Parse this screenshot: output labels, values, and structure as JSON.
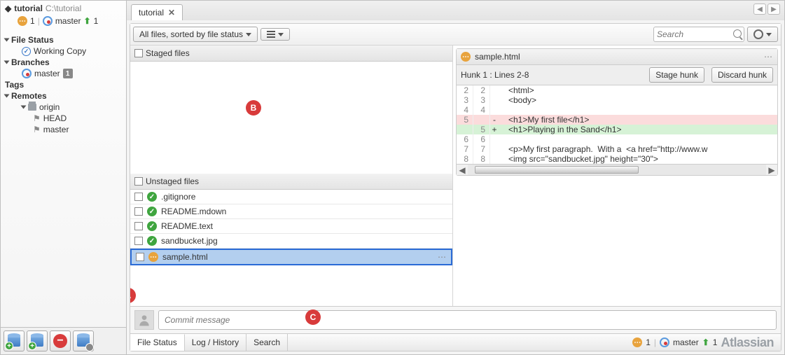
{
  "repo": {
    "name": "tutorial",
    "path": "C:\\tutorial",
    "pending": "1",
    "branch": "master",
    "ahead": "1"
  },
  "sidebar": {
    "file_status": "File Status",
    "working_copy": "Working Copy",
    "branches": "Branches",
    "master": "master",
    "master_count": "1",
    "tags": "Tags",
    "remotes": "Remotes",
    "origin": "origin",
    "head": "HEAD",
    "remote_master": "master"
  },
  "tab": {
    "label": "tutorial"
  },
  "toolbar": {
    "filter": "All files, sorted by file status"
  },
  "search": {
    "placeholder": "Search"
  },
  "staged_header": "Staged files",
  "unstaged_header": "Unstaged files",
  "unstaged": [
    {
      "name": ".gitignore",
      "status": "clean"
    },
    {
      "name": "README.mdown",
      "status": "clean"
    },
    {
      "name": "README.text",
      "status": "clean"
    },
    {
      "name": "sandbucket.jpg",
      "status": "clean"
    },
    {
      "name": "sample.html",
      "status": "modified",
      "selected": true
    }
  ],
  "diff": {
    "filename": "sample.html",
    "hunk": "Hunk 1 : Lines 2-8",
    "stage_btn": "Stage hunk",
    "discard_btn": "Discard hunk",
    "lines": [
      {
        "a": "2",
        "b": "2",
        "m": " ",
        "t": "   <html>"
      },
      {
        "a": "3",
        "b": "3",
        "m": " ",
        "t": "   <body>"
      },
      {
        "a": "4",
        "b": "4",
        "m": " ",
        "t": ""
      },
      {
        "a": "5",
        "b": "",
        "m": "-",
        "t": "   <h1>My first file</h1>",
        "cls": "del"
      },
      {
        "a": "",
        "b": "5",
        "m": "+",
        "t": "   <h1>Playing in the Sand</h1>",
        "cls": "add"
      },
      {
        "a": "6",
        "b": "6",
        "m": " ",
        "t": ""
      },
      {
        "a": "7",
        "b": "7",
        "m": " ",
        "t": "   <p>My first paragraph.  With a  <a href=\"http://www.w"
      },
      {
        "a": "8",
        "b": "8",
        "m": " ",
        "t": "   <img src=\"sandbucket.jpg\" height=\"30\">"
      }
    ]
  },
  "commit": {
    "placeholder": "Commit message"
  },
  "footer": {
    "tabs": [
      "File Status",
      "Log / History",
      "Search"
    ],
    "pending": "1",
    "branch": "master",
    "ahead": "1",
    "brand": "Atlassian"
  },
  "markers": {
    "a": "A",
    "b": "B",
    "c": "C"
  }
}
